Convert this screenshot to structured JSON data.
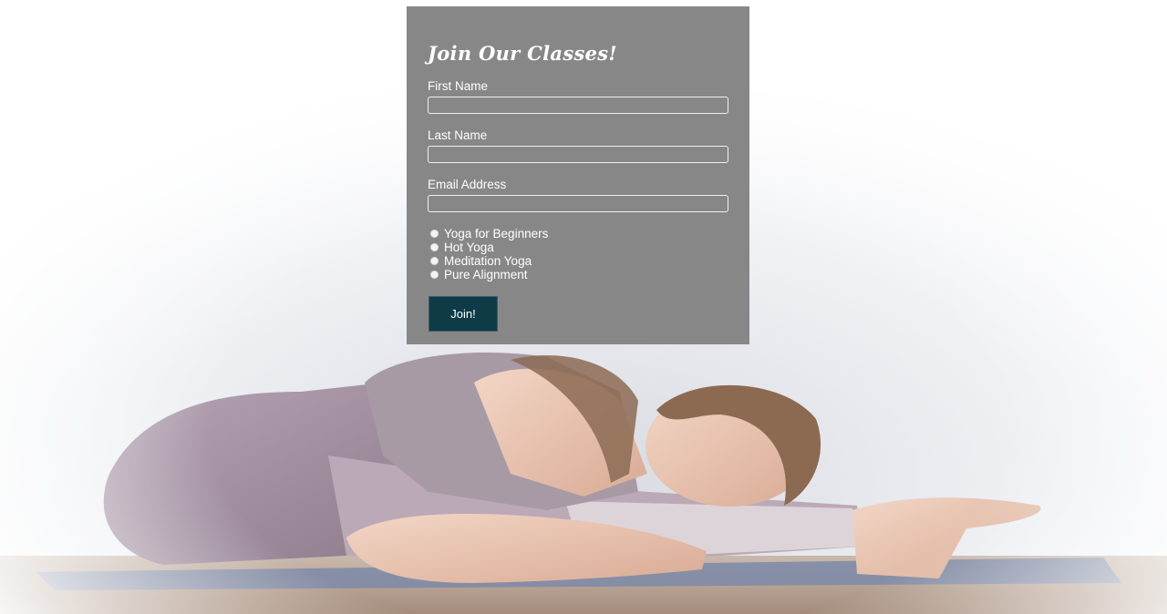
{
  "form": {
    "title": "Join Our Classes!",
    "first_name": {
      "label": "First Name",
      "value": "",
      "placeholder": ""
    },
    "last_name": {
      "label": "Last Name",
      "value": "",
      "placeholder": ""
    },
    "email": {
      "label": "Email Address",
      "value": "",
      "placeholder": ""
    },
    "classes": [
      {
        "label": "Yoga for Beginners",
        "selected": false
      },
      {
        "label": "Hot Yoga",
        "selected": false
      },
      {
        "label": "Meditation Yoga",
        "selected": false
      },
      {
        "label": "Pure Alignment",
        "selected": false
      }
    ],
    "submit_label": "Join!"
  },
  "colors": {
    "panel_background": "#878787",
    "button_background": "#0d3c47",
    "text": "#ffffff"
  },
  "background_image": {
    "subject": "woman in a seated forward-fold stretch on a yoga mat"
  }
}
